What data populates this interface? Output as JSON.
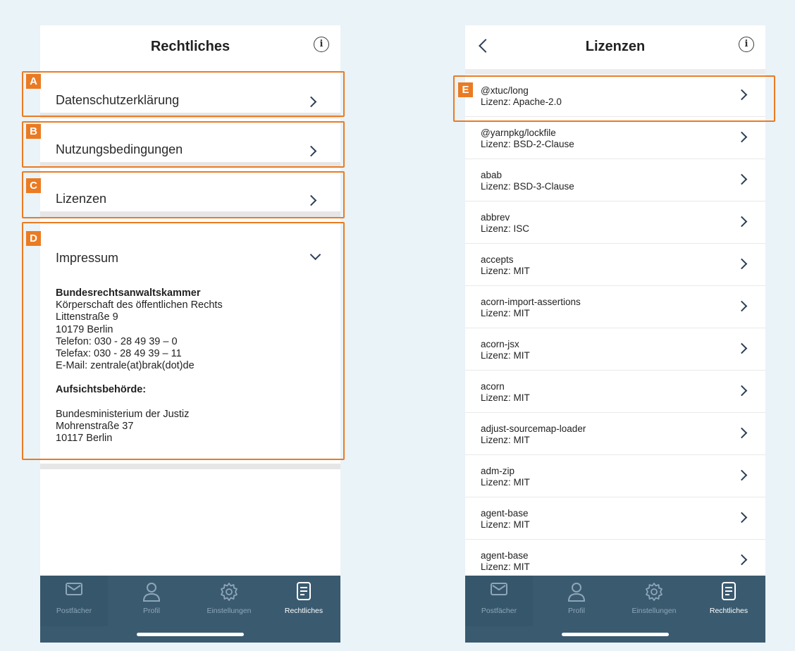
{
  "colors": {
    "background": "#eaf3f7",
    "annotation": "#ea7b22",
    "tabbar": "#3a5a70",
    "tab_inactive_text": "#8ea6b8",
    "tab_active_text": "#ffffff",
    "chevron": "#2b3f57"
  },
  "left": {
    "header": {
      "title": "Rechtliches",
      "info_icon": "info-icon"
    },
    "rows": [
      {
        "label": "Datenschutzerklärung",
        "annotation": "A"
      },
      {
        "label": "Nutzungsbedingungen",
        "annotation": "B"
      },
      {
        "label": "Lizenzen",
        "annotation": "C"
      }
    ],
    "impressum": {
      "label": "Impressum",
      "annotation": "D",
      "org": "Bundesrechtsanwaltskammer",
      "lines": [
        "Körperschaft des öffentlichen Rechts",
        "Littenstraße 9",
        "10179 Berlin",
        "Telefon: 030 - 28 49 39 – 0",
        "Telefax: 030 - 28 49 39 – 11",
        "E-Mail: zentrale(at)brak(dot)de"
      ],
      "authority_heading": "Aufsichtsbehörde:",
      "authority_lines": [
        "Bundesministerium der Justiz",
        "Mohrenstraße 37",
        "10117 Berlin"
      ]
    }
  },
  "right": {
    "header": {
      "title": "Lizenzen",
      "back_icon": "back-chevron-icon",
      "info_icon": "info-icon"
    },
    "annotation": "E",
    "licenses": [
      {
        "name": "@xtuc/long",
        "license": "Lizenz: Apache-2.0"
      },
      {
        "name": "@yarnpkg/lockfile",
        "license": "Lizenz: BSD-2-Clause"
      },
      {
        "name": "abab",
        "license": "Lizenz: BSD-3-Clause"
      },
      {
        "name": "abbrev",
        "license": "Lizenz: ISC"
      },
      {
        "name": "accepts",
        "license": "Lizenz: MIT"
      },
      {
        "name": "acorn-import-assertions",
        "license": "Lizenz: MIT"
      },
      {
        "name": "acorn-jsx",
        "license": "Lizenz: MIT"
      },
      {
        "name": "acorn",
        "license": "Lizenz: MIT"
      },
      {
        "name": "adjust-sourcemap-loader",
        "license": "Lizenz: MIT"
      },
      {
        "name": "adm-zip",
        "license": "Lizenz: MIT"
      },
      {
        "name": "agent-base",
        "license": "Lizenz: MIT"
      },
      {
        "name": "agent-base",
        "license": "Lizenz: MIT"
      }
    ]
  },
  "tabbar": {
    "tabs": [
      {
        "label": "Postfächer",
        "icon": "mail-icon"
      },
      {
        "label": "Profil",
        "icon": "user-icon"
      },
      {
        "label": "Einstellungen",
        "icon": "gear-icon"
      },
      {
        "label": "Rechtliches",
        "icon": "document-icon",
        "selected": true
      }
    ]
  }
}
